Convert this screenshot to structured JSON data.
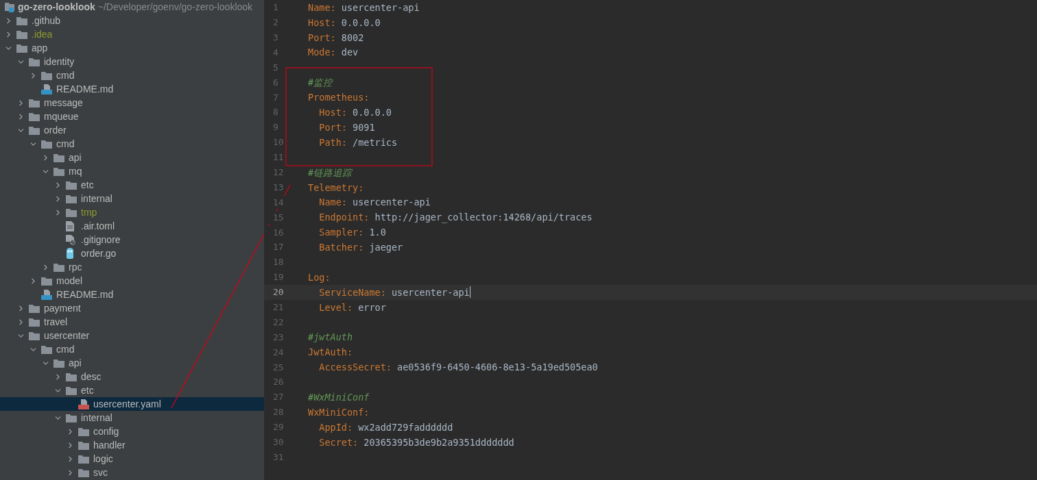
{
  "project": {
    "name": "go-zero-looklook",
    "path": "~/Developer/goenv/go-zero-looklook"
  },
  "tree": [
    {
      "kind": "folder",
      "label": ".github",
      "expanded": false,
      "ignored": false,
      "selected": false
    },
    {
      "kind": "folder",
      "label": ".idea",
      "expanded": false,
      "ignored": true,
      "selected": false
    },
    {
      "kind": "folder",
      "label": "app",
      "expanded": true,
      "ignored": false,
      "selected": false,
      "children": [
        {
          "kind": "folder",
          "label": "identity",
          "expanded": true,
          "ignored": false,
          "selected": false,
          "children": [
            {
              "kind": "folder",
              "label": "cmd",
              "expanded": false,
              "ignored": false,
              "selected": false
            },
            {
              "kind": "markdown",
              "label": "README.md",
              "ignored": false,
              "selected": false
            }
          ]
        },
        {
          "kind": "folder",
          "label": "message",
          "expanded": false,
          "ignored": false,
          "selected": false
        },
        {
          "kind": "folder",
          "label": "mqueue",
          "expanded": false,
          "ignored": false,
          "selected": false
        },
        {
          "kind": "folder",
          "label": "order",
          "expanded": true,
          "ignored": false,
          "selected": false,
          "children": [
            {
              "kind": "folder",
              "label": "cmd",
              "expanded": true,
              "ignored": false,
              "selected": false,
              "children": [
                {
                  "kind": "folder",
                  "label": "api",
                  "expanded": false,
                  "ignored": false,
                  "selected": false
                },
                {
                  "kind": "folder",
                  "label": "mq",
                  "expanded": true,
                  "ignored": false,
                  "selected": false,
                  "children": [
                    {
                      "kind": "folder",
                      "label": "etc",
                      "expanded": false,
                      "ignored": false,
                      "selected": false
                    },
                    {
                      "kind": "folder",
                      "label": "internal",
                      "expanded": false,
                      "ignored": false,
                      "selected": false
                    },
                    {
                      "kind": "folder",
                      "label": "tmp",
                      "expanded": false,
                      "ignored": true,
                      "selected": false
                    },
                    {
                      "kind": "text",
                      "label": ".air.toml",
                      "ignored": false,
                      "selected": false
                    },
                    {
                      "kind": "gitignore",
                      "label": ".gitignore",
                      "ignored": false,
                      "selected": false
                    },
                    {
                      "kind": "go",
                      "label": "order.go",
                      "ignored": false,
                      "selected": false
                    }
                  ]
                },
                {
                  "kind": "folder",
                  "label": "rpc",
                  "expanded": false,
                  "ignored": false,
                  "selected": false
                }
              ]
            },
            {
              "kind": "folder",
              "label": "model",
              "expanded": false,
              "ignored": false,
              "selected": false
            },
            {
              "kind": "markdown",
              "label": "README.md",
              "ignored": false,
              "selected": false
            }
          ]
        },
        {
          "kind": "folder",
          "label": "payment",
          "expanded": false,
          "ignored": false,
          "selected": false
        },
        {
          "kind": "folder",
          "label": "travel",
          "expanded": false,
          "ignored": false,
          "selected": false
        },
        {
          "kind": "folder",
          "label": "usercenter",
          "expanded": true,
          "ignored": false,
          "selected": false,
          "children": [
            {
              "kind": "folder",
              "label": "cmd",
              "expanded": true,
              "ignored": false,
              "selected": false,
              "children": [
                {
                  "kind": "folder",
                  "label": "api",
                  "expanded": true,
                  "ignored": false,
                  "selected": false,
                  "children": [
                    {
                      "kind": "folder",
                      "label": "desc",
                      "expanded": false,
                      "ignored": false,
                      "selected": false
                    },
                    {
                      "kind": "folder",
                      "label": "etc",
                      "expanded": true,
                      "ignored": false,
                      "selected": false,
                      "children": [
                        {
                          "kind": "yaml",
                          "label": "usercenter.yaml",
                          "ignored": false,
                          "selected": true
                        }
                      ]
                    },
                    {
                      "kind": "folder",
                      "label": "internal",
                      "expanded": true,
                      "ignored": false,
                      "selected": false,
                      "children": [
                        {
                          "kind": "folder",
                          "label": "config",
                          "expanded": false,
                          "ignored": false,
                          "selected": false
                        },
                        {
                          "kind": "folder",
                          "label": "handler",
                          "expanded": false,
                          "ignored": false,
                          "selected": false
                        },
                        {
                          "kind": "folder",
                          "label": "logic",
                          "expanded": false,
                          "ignored": false,
                          "selected": false
                        },
                        {
                          "kind": "folder",
                          "label": "svc",
                          "expanded": false,
                          "ignored": false,
                          "selected": false
                        }
                      ]
                    }
                  ]
                }
              ]
            }
          ]
        }
      ]
    }
  ],
  "editor": {
    "lines": [
      {
        "number": "1",
        "current": false,
        "tokens": [
          {
            "kind": "key",
            "text": "Name"
          },
          {
            "kind": "punct",
            "text": ": "
          },
          {
            "kind": "value",
            "text": "usercenter-api"
          }
        ]
      },
      {
        "number": "2",
        "current": false,
        "tokens": [
          {
            "kind": "key",
            "text": "Host"
          },
          {
            "kind": "punct",
            "text": ": "
          },
          {
            "kind": "value",
            "text": "0.0.0.0"
          }
        ]
      },
      {
        "number": "3",
        "current": false,
        "tokens": [
          {
            "kind": "key",
            "text": "Port"
          },
          {
            "kind": "punct",
            "text": ": "
          },
          {
            "kind": "value",
            "text": "8002"
          }
        ]
      },
      {
        "number": "4",
        "current": false,
        "tokens": [
          {
            "kind": "key",
            "text": "Mode"
          },
          {
            "kind": "punct",
            "text": ": "
          },
          {
            "kind": "value",
            "text": "dev"
          }
        ]
      },
      {
        "number": "5",
        "current": false
      },
      {
        "number": "6",
        "current": false,
        "tokens": [
          {
            "kind": "comment",
            "text": "#监控"
          }
        ]
      },
      {
        "number": "7",
        "current": false,
        "tokens": [
          {
            "kind": "key",
            "text": "Prometheus"
          },
          {
            "kind": "punct",
            "text": ":"
          }
        ]
      },
      {
        "number": "8",
        "current": false,
        "tokens": [
          {
            "kind": "key",
            "text": "  Host"
          },
          {
            "kind": "punct",
            "text": ": "
          },
          {
            "kind": "value",
            "text": "0.0.0.0"
          }
        ]
      },
      {
        "number": "9",
        "current": false,
        "tokens": [
          {
            "kind": "key",
            "text": "  Port"
          },
          {
            "kind": "punct",
            "text": ": "
          },
          {
            "kind": "value",
            "text": "9091"
          }
        ]
      },
      {
        "number": "10",
        "current": false,
        "tokens": [
          {
            "kind": "key",
            "text": "  Path"
          },
          {
            "kind": "punct",
            "text": ": "
          },
          {
            "kind": "value",
            "text": "/metrics"
          }
        ]
      },
      {
        "number": "11",
        "current": false
      },
      {
        "number": "12",
        "current": false,
        "tokens": [
          {
            "kind": "comment",
            "text": "#链路追踪"
          }
        ]
      },
      {
        "number": "13",
        "current": false,
        "tokens": [
          {
            "kind": "key",
            "text": "Telemetry"
          },
          {
            "kind": "punct",
            "text": ":"
          }
        ]
      },
      {
        "number": "14",
        "current": false,
        "tokens": [
          {
            "kind": "key",
            "text": "  Name"
          },
          {
            "kind": "punct",
            "text": ": "
          },
          {
            "kind": "value",
            "text": "usercenter-api"
          }
        ]
      },
      {
        "number": "15",
        "current": false,
        "tokens": [
          {
            "kind": "key",
            "text": "  Endpoint"
          },
          {
            "kind": "punct",
            "text": ": "
          },
          {
            "kind": "value",
            "text": "http://jager_collector:14268/api/traces"
          }
        ]
      },
      {
        "number": "16",
        "current": false,
        "tokens": [
          {
            "kind": "key",
            "text": "  Sampler"
          },
          {
            "kind": "punct",
            "text": ": "
          },
          {
            "kind": "value",
            "text": "1.0"
          }
        ]
      },
      {
        "number": "17",
        "current": false,
        "tokens": [
          {
            "kind": "key",
            "text": "  Batcher"
          },
          {
            "kind": "punct",
            "text": ": "
          },
          {
            "kind": "value",
            "text": "jaeger"
          }
        ]
      },
      {
        "number": "18",
        "current": false
      },
      {
        "number": "19",
        "current": false,
        "tokens": [
          {
            "kind": "key",
            "text": "Log"
          },
          {
            "kind": "punct",
            "text": ":"
          }
        ]
      },
      {
        "number": "20",
        "current": true,
        "tokens": [
          {
            "kind": "key",
            "text": "  ServiceName"
          },
          {
            "kind": "punct",
            "text": ": "
          },
          {
            "kind": "value",
            "text": "usercenter-api"
          }
        ]
      },
      {
        "number": "21",
        "current": false,
        "tokens": [
          {
            "kind": "key",
            "text": "  Level"
          },
          {
            "kind": "punct",
            "text": ": "
          },
          {
            "kind": "value",
            "text": "error"
          }
        ]
      },
      {
        "number": "22",
        "current": false
      },
      {
        "number": "23",
        "current": false,
        "tokens": [
          {
            "kind": "comment",
            "text": "#jwtAuth"
          }
        ]
      },
      {
        "number": "24",
        "current": false,
        "tokens": [
          {
            "kind": "key",
            "text": "JwtAuth"
          },
          {
            "kind": "punct",
            "text": ":"
          }
        ]
      },
      {
        "number": "25",
        "current": false,
        "tokens": [
          {
            "kind": "key",
            "text": "  AccessSecret"
          },
          {
            "kind": "punct",
            "text": ": "
          },
          {
            "kind": "value",
            "text": "ae0536f9-6450-4606-8e13-5a19ed505ea0"
          }
        ]
      },
      {
        "number": "26",
        "current": false
      },
      {
        "number": "27",
        "current": false,
        "tokens": [
          {
            "kind": "comment",
            "text": "#WxMiniConf"
          }
        ]
      },
      {
        "number": "28",
        "current": false,
        "tokens": [
          {
            "kind": "key",
            "text": "WxMiniConf"
          },
          {
            "kind": "punct",
            "text": ":"
          }
        ]
      },
      {
        "number": "29",
        "current": false,
        "tokens": [
          {
            "kind": "key",
            "text": "  AppId"
          },
          {
            "kind": "punct",
            "text": ": "
          },
          {
            "kind": "value",
            "text": "wx2add729fadddddd"
          }
        ]
      },
      {
        "number": "30",
        "current": false,
        "tokens": [
          {
            "kind": "key",
            "text": "  Secret"
          },
          {
            "kind": "punct",
            "text": ": "
          },
          {
            "kind": "value",
            "text": "20365395b3de9b2a9351ddddddd"
          }
        ]
      },
      {
        "number": "31",
        "current": false
      }
    ]
  }
}
